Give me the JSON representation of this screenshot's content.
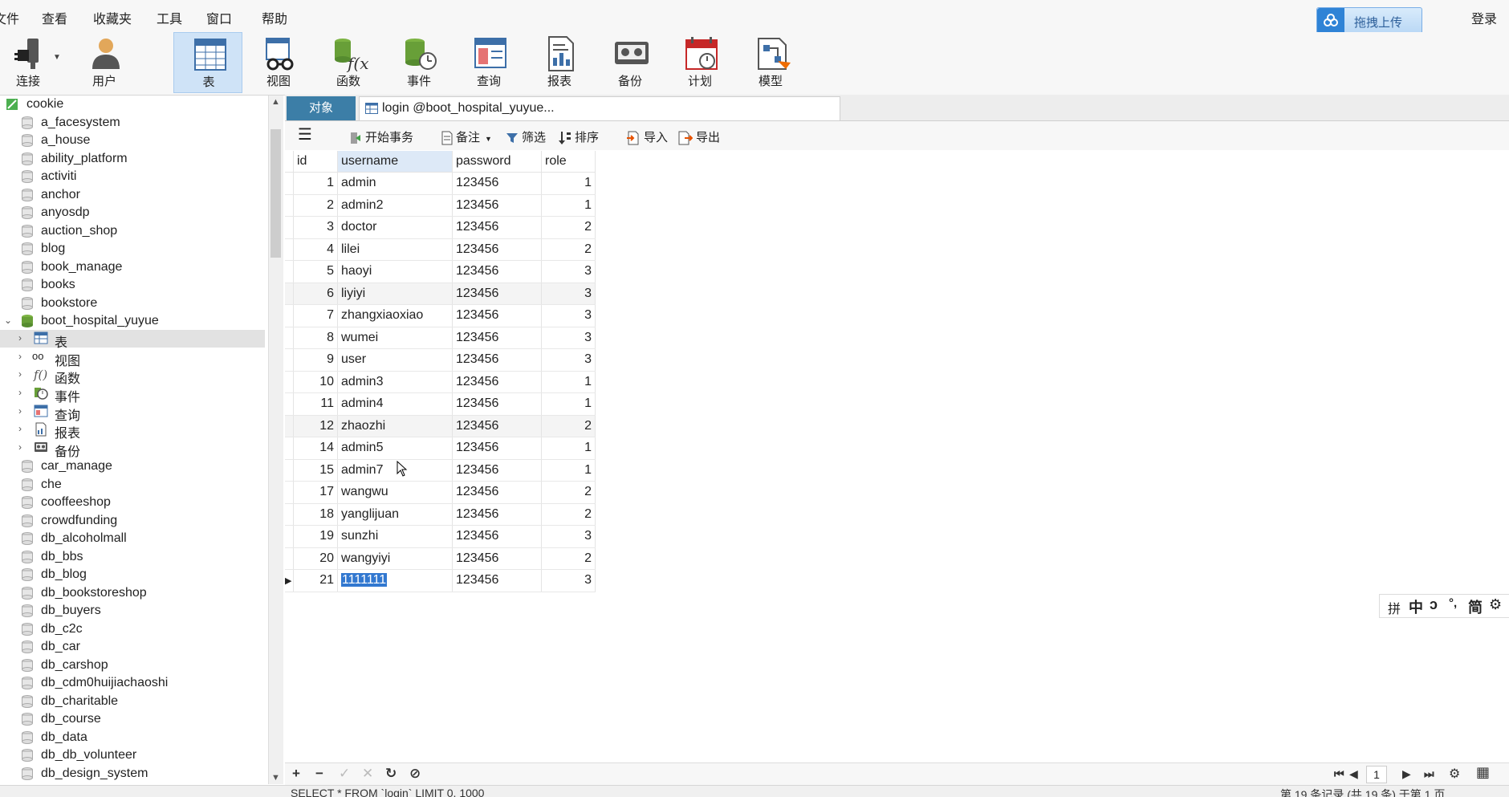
{
  "menu": [
    "文件",
    "查看",
    "收藏夹",
    "工具",
    "窗口",
    "帮助"
  ],
  "upload_label": "拖拽上传",
  "login_label": "登录",
  "toolbar": [
    {
      "label": "连接",
      "icon": "plug-icon"
    },
    {
      "label": "用户",
      "icon": "user-icon"
    },
    {
      "label": "表",
      "icon": "table-icon"
    },
    {
      "label": "视图",
      "icon": "view-icon"
    },
    {
      "label": "函数",
      "icon": "function-icon"
    },
    {
      "label": "事件",
      "icon": "event-icon"
    },
    {
      "label": "查询",
      "icon": "query-icon"
    },
    {
      "label": "报表",
      "icon": "report-icon"
    },
    {
      "label": "备份",
      "icon": "backup-icon"
    },
    {
      "label": "计划",
      "icon": "schedule-icon"
    },
    {
      "label": "模型",
      "icon": "model-icon"
    }
  ],
  "tree": {
    "connection": "cookie",
    "databases_before": [
      "a_facesystem",
      "a_house",
      "ability_platform",
      "activiti",
      "anchor",
      "anyosdp",
      "auction_shop",
      "blog",
      "book_manage",
      "books",
      "bookstore"
    ],
    "open_db": "boot_hospital_yuyue",
    "open_db_children": [
      "表",
      "视图",
      "函数",
      "事件",
      "查询",
      "报表",
      "备份"
    ],
    "databases_after": [
      "car_manage",
      "che",
      "cooffeeshop",
      "crowdfunding",
      "db_alcoholmall",
      "db_bbs",
      "db_blog",
      "db_bookstoreshop",
      "db_buyers",
      "db_c2c",
      "db_car",
      "db_carshop",
      "db_cdm0huijiachaoshi",
      "db_charitable",
      "db_course",
      "db_data",
      "db_db_volunteer",
      "db_design_system"
    ]
  },
  "tabs": {
    "objects": "对象",
    "login": "login @boot_hospital_yuyue..."
  },
  "subtoolbar": {
    "begin_tx": "开始事务",
    "note": "备注",
    "filter": "筛选",
    "sort": "排序",
    "import": "导入",
    "export": "导出"
  },
  "table": {
    "columns": [
      "id",
      "username",
      "password",
      "role"
    ],
    "rows": [
      [
        "1",
        "admin",
        "123456",
        "1"
      ],
      [
        "2",
        "admin2",
        "123456",
        "1"
      ],
      [
        "3",
        "doctor",
        "123456",
        "2"
      ],
      [
        "4",
        "lilei",
        "123456",
        "2"
      ],
      [
        "5",
        "haoyi",
        "123456",
        "3"
      ],
      [
        "6",
        "liyiyi",
        "123456",
        "3"
      ],
      [
        "7",
        "zhangxiaoxiao",
        "123456",
        "3"
      ],
      [
        "8",
        "wumei",
        "123456",
        "3"
      ],
      [
        "9",
        "user",
        "123456",
        "3"
      ],
      [
        "10",
        "admin3",
        "123456",
        "1"
      ],
      [
        "11",
        "admin4",
        "123456",
        "1"
      ],
      [
        "12",
        "zhaozhi",
        "123456",
        "2"
      ],
      [
        "14",
        "admin5",
        "123456",
        "1"
      ],
      [
        "15",
        "admin7",
        "123456",
        "1"
      ],
      [
        "17",
        "wangwu",
        "123456",
        "2"
      ],
      [
        "18",
        "yanglijuan",
        "123456",
        "2"
      ],
      [
        "19",
        "sunzhi",
        "123456",
        "3"
      ],
      [
        "20",
        "wangyiyi",
        "123456",
        "2"
      ],
      [
        "21",
        "1111111",
        "123456",
        "3"
      ]
    ]
  },
  "ime": [
    "拼",
    "中",
    "ↄ",
    "°,",
    "简",
    "⚙"
  ],
  "pager": {
    "page": "1"
  },
  "status": {
    "sql": "SELECT * FROM `login` LIMIT 0, 1000",
    "records": "第 19 条记录 (共 19 条) 于第 1 页"
  },
  "colors": {
    "accent": "#3c7ea7",
    "selection": "#3278d0",
    "active_tool": "#cfe3f7"
  }
}
